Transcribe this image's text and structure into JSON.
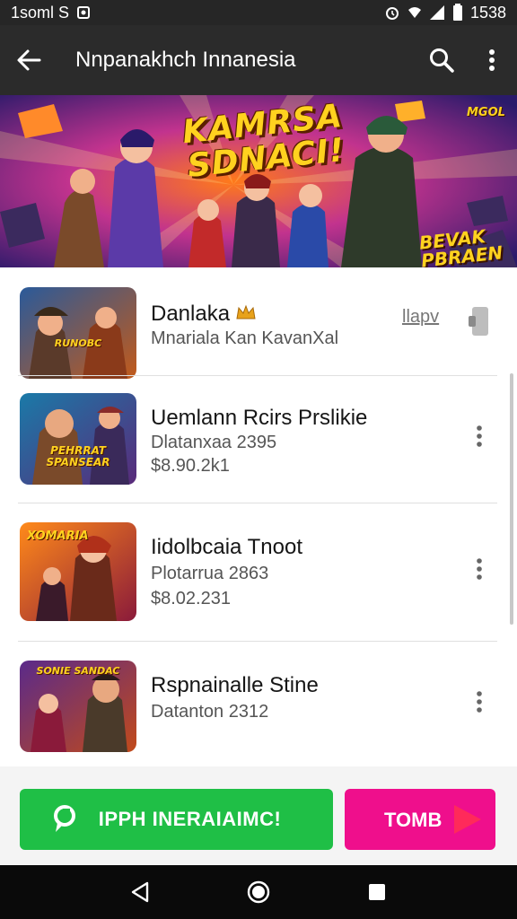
{
  "status_bar": {
    "left_text": "1soml S",
    "time": "1538"
  },
  "app_bar": {
    "title": "Nnpanakhch Innanesia",
    "back_icon": "arrow-left-icon",
    "search_icon": "search-icon",
    "more_icon": "more-vert-icon"
  },
  "banner": {
    "title_line1": "KAMRSA",
    "title_line2": "SDNACI!",
    "side_line1": "BEVAK",
    "side_line2": "PBRAEN",
    "corner_text": "MGOL"
  },
  "list": {
    "items": [
      {
        "name": "Danlaka",
        "subtitle": "Mnariala Kan KavanXal",
        "price": "",
        "action": "llapv",
        "thumb_text": "RUNOBC"
      },
      {
        "name": "Uemlann Rcirs Prslikie",
        "subtitle": "Dlatanxaa 2395",
        "price": "$8.90.2k1",
        "thumb_text": "PEHRRAT SPANSEAR"
      },
      {
        "name": "Iidolbcaia Tnoot",
        "subtitle": "Plotarrua 2863",
        "price": "$8.02.231",
        "thumb_text": "XOMARIA"
      },
      {
        "name": "Rspnainalle Stine",
        "subtitle": "Datanton 2312",
        "price": "",
        "thumb_text": "SONIE SANDAC"
      }
    ]
  },
  "actions": {
    "primary_label": "IPPH INERAIAIMC!",
    "secondary_label": "TOMB"
  },
  "colors": {
    "app_bar": "#2b2b2b",
    "primary_button": "#1fbf46",
    "secondary_button": "#ef0f8c",
    "nav_bar": "#0a0a0a"
  }
}
